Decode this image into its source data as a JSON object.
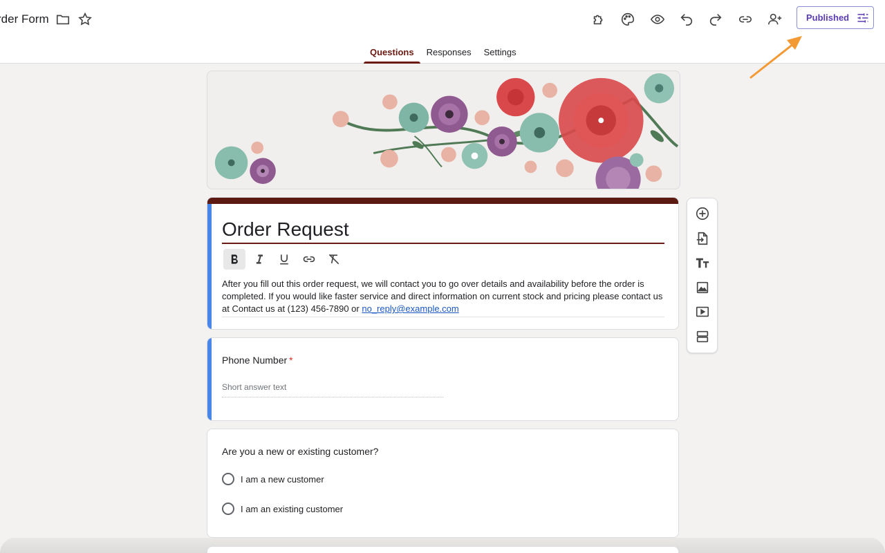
{
  "header": {
    "doc_title": "rder Form",
    "published_label": "Published"
  },
  "tabs": [
    {
      "label": "Questions",
      "active": true
    },
    {
      "label": "Responses",
      "active": false
    },
    {
      "label": "Settings",
      "active": false
    }
  ],
  "form": {
    "title": "Order Request",
    "description_text": "After you fill out this order request, we will contact you to go over details and availability before the order is completed. If you would like faster service and direct information on current stock and pricing please contact us at Contact us at (123) 456-7890 or ",
    "description_link": "no_reply@example.com"
  },
  "questions": [
    {
      "title": "Phone Number",
      "required_mark": "*",
      "placeholder": "Short answer text"
    },
    {
      "title": "Are you a new or existing customer?",
      "options": [
        "I am a new customer",
        "I am an existing customer"
      ]
    }
  ],
  "colors": {
    "theme": "#6b1a12",
    "focus_bar": "#4a86e8",
    "published_text": "#5b3bb1",
    "link": "#1a57c5",
    "annotation_arrow": "#f39a35"
  }
}
